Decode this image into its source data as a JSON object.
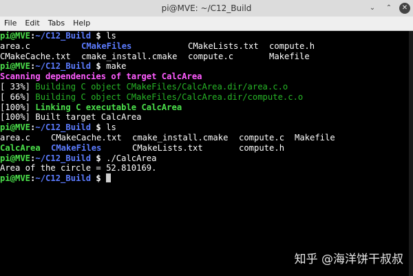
{
  "window": {
    "title": "pi@MVE: ~/C12_Build",
    "buttons": {
      "minimize": "⌄",
      "maximize": "⌃",
      "close": "✕"
    }
  },
  "menu": [
    "File",
    "Edit",
    "Tabs",
    "Help"
  ],
  "prompt": {
    "user_host": "pi@MVE",
    "separator": ":",
    "path": "~/C12_Build",
    "symbol": " $ "
  },
  "commands": {
    "ls": "ls",
    "make": "make",
    "run": "./CalcArea"
  },
  "ls1": {
    "row1": [
      "area.c",
      "CMakeFiles",
      "CMakeLists.txt",
      "compute.h"
    ],
    "row2": [
      "CMakeCache.txt",
      "cmake_install.cmake",
      "compute.c",
      "Makefile"
    ]
  },
  "make_output": {
    "scanning": "Scanning dependencies of target CalcArea",
    "build1_pct": "[ 33%]",
    "build1_text": " Building C object CMakeFiles/CalcArea.dir/area.c.o",
    "build2_pct": "[ 66%]",
    "build2_text": " Building C object CMakeFiles/CalcArea.dir/compute.c.o",
    "link_pct": "[100%]",
    "link_text": " Linking C executable CalcArea",
    "built": "[100%] Built target CalcArea"
  },
  "ls2": {
    "row1": [
      "area.c",
      "CMakeCache.txt",
      "cmake_install.cmake",
      "compute.c",
      "Makefile"
    ],
    "row2": [
      "CalcArea",
      "CMakeFiles",
      "CMakeLists.txt",
      "compute.h"
    ]
  },
  "program_output": "Area of the circle = 52.810169.",
  "watermark": "知乎 @海洋饼干叔叔",
  "colors": {
    "prompt_green": "#4be04b",
    "dir_blue": "#5c7cff",
    "magenta": "#ff5cff",
    "build_green": "#27b627"
  }
}
